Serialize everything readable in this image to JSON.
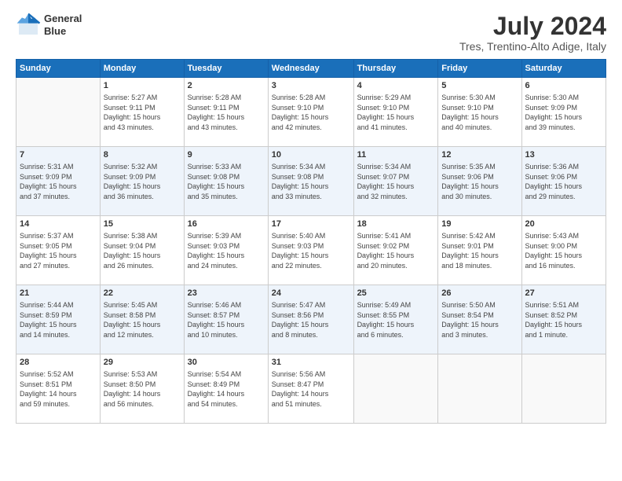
{
  "logo": {
    "line1": "General",
    "line2": "Blue"
  },
  "title": "July 2024",
  "subtitle": "Tres, Trentino-Alto Adige, Italy",
  "days_of_week": [
    "Sunday",
    "Monday",
    "Tuesday",
    "Wednesday",
    "Thursday",
    "Friday",
    "Saturday"
  ],
  "weeks": [
    [
      {
        "day": "",
        "info": ""
      },
      {
        "day": "1",
        "info": "Sunrise: 5:27 AM\nSunset: 9:11 PM\nDaylight: 15 hours\nand 43 minutes."
      },
      {
        "day": "2",
        "info": "Sunrise: 5:28 AM\nSunset: 9:11 PM\nDaylight: 15 hours\nand 43 minutes."
      },
      {
        "day": "3",
        "info": "Sunrise: 5:28 AM\nSunset: 9:10 PM\nDaylight: 15 hours\nand 42 minutes."
      },
      {
        "day": "4",
        "info": "Sunrise: 5:29 AM\nSunset: 9:10 PM\nDaylight: 15 hours\nand 41 minutes."
      },
      {
        "day": "5",
        "info": "Sunrise: 5:30 AM\nSunset: 9:10 PM\nDaylight: 15 hours\nand 40 minutes."
      },
      {
        "day": "6",
        "info": "Sunrise: 5:30 AM\nSunset: 9:09 PM\nDaylight: 15 hours\nand 39 minutes."
      }
    ],
    [
      {
        "day": "7",
        "info": "Sunrise: 5:31 AM\nSunset: 9:09 PM\nDaylight: 15 hours\nand 37 minutes."
      },
      {
        "day": "8",
        "info": "Sunrise: 5:32 AM\nSunset: 9:09 PM\nDaylight: 15 hours\nand 36 minutes."
      },
      {
        "day": "9",
        "info": "Sunrise: 5:33 AM\nSunset: 9:08 PM\nDaylight: 15 hours\nand 35 minutes."
      },
      {
        "day": "10",
        "info": "Sunrise: 5:34 AM\nSunset: 9:08 PM\nDaylight: 15 hours\nand 33 minutes."
      },
      {
        "day": "11",
        "info": "Sunrise: 5:34 AM\nSunset: 9:07 PM\nDaylight: 15 hours\nand 32 minutes."
      },
      {
        "day": "12",
        "info": "Sunrise: 5:35 AM\nSunset: 9:06 PM\nDaylight: 15 hours\nand 30 minutes."
      },
      {
        "day": "13",
        "info": "Sunrise: 5:36 AM\nSunset: 9:06 PM\nDaylight: 15 hours\nand 29 minutes."
      }
    ],
    [
      {
        "day": "14",
        "info": "Sunrise: 5:37 AM\nSunset: 9:05 PM\nDaylight: 15 hours\nand 27 minutes."
      },
      {
        "day": "15",
        "info": "Sunrise: 5:38 AM\nSunset: 9:04 PM\nDaylight: 15 hours\nand 26 minutes."
      },
      {
        "day": "16",
        "info": "Sunrise: 5:39 AM\nSunset: 9:03 PM\nDaylight: 15 hours\nand 24 minutes."
      },
      {
        "day": "17",
        "info": "Sunrise: 5:40 AM\nSunset: 9:03 PM\nDaylight: 15 hours\nand 22 minutes."
      },
      {
        "day": "18",
        "info": "Sunrise: 5:41 AM\nSunset: 9:02 PM\nDaylight: 15 hours\nand 20 minutes."
      },
      {
        "day": "19",
        "info": "Sunrise: 5:42 AM\nSunset: 9:01 PM\nDaylight: 15 hours\nand 18 minutes."
      },
      {
        "day": "20",
        "info": "Sunrise: 5:43 AM\nSunset: 9:00 PM\nDaylight: 15 hours\nand 16 minutes."
      }
    ],
    [
      {
        "day": "21",
        "info": "Sunrise: 5:44 AM\nSunset: 8:59 PM\nDaylight: 15 hours\nand 14 minutes."
      },
      {
        "day": "22",
        "info": "Sunrise: 5:45 AM\nSunset: 8:58 PM\nDaylight: 15 hours\nand 12 minutes."
      },
      {
        "day": "23",
        "info": "Sunrise: 5:46 AM\nSunset: 8:57 PM\nDaylight: 15 hours\nand 10 minutes."
      },
      {
        "day": "24",
        "info": "Sunrise: 5:47 AM\nSunset: 8:56 PM\nDaylight: 15 hours\nand 8 minutes."
      },
      {
        "day": "25",
        "info": "Sunrise: 5:49 AM\nSunset: 8:55 PM\nDaylight: 15 hours\nand 6 minutes."
      },
      {
        "day": "26",
        "info": "Sunrise: 5:50 AM\nSunset: 8:54 PM\nDaylight: 15 hours\nand 3 minutes."
      },
      {
        "day": "27",
        "info": "Sunrise: 5:51 AM\nSunset: 8:52 PM\nDaylight: 15 hours\nand 1 minute."
      }
    ],
    [
      {
        "day": "28",
        "info": "Sunrise: 5:52 AM\nSunset: 8:51 PM\nDaylight: 14 hours\nand 59 minutes."
      },
      {
        "day": "29",
        "info": "Sunrise: 5:53 AM\nSunset: 8:50 PM\nDaylight: 14 hours\nand 56 minutes."
      },
      {
        "day": "30",
        "info": "Sunrise: 5:54 AM\nSunset: 8:49 PM\nDaylight: 14 hours\nand 54 minutes."
      },
      {
        "day": "31",
        "info": "Sunrise: 5:56 AM\nSunset: 8:47 PM\nDaylight: 14 hours\nand 51 minutes."
      },
      {
        "day": "",
        "info": ""
      },
      {
        "day": "",
        "info": ""
      },
      {
        "day": "",
        "info": ""
      }
    ]
  ]
}
